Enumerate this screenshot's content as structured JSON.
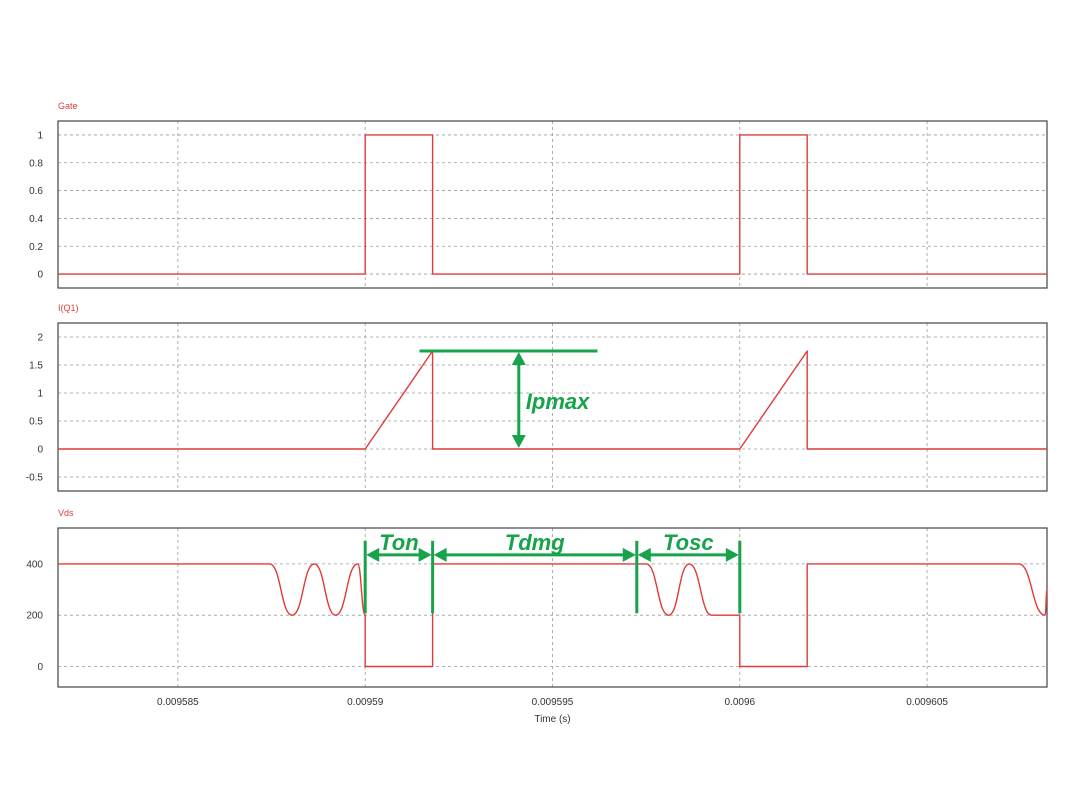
{
  "colors": {
    "trace": "#e03a3a",
    "annotation": "#16a34a"
  },
  "chart_data": {
    "type": "line",
    "xlabel": "Time (s)",
    "x_tick_labels": [
      "0.009585",
      "0.00959",
      "0.009595",
      "0.0096",
      "0.009605"
    ],
    "xlim": [
      0.0095818,
      0.0096082
    ],
    "grid": true,
    "panels": [
      {
        "title": "Gate",
        "ylim": [
          -0.1,
          1.1
        ],
        "y_tick_labels": [
          "1",
          "0.8",
          "0.6",
          "0.4",
          "0.2",
          "0"
        ],
        "series": [
          {
            "name": "Gate",
            "x": [
              0.0095818,
              0.00959,
              0.00959,
              0.0095918,
              0.0095918,
              0.0096,
              0.0096,
              0.0096018,
              0.0096018,
              0.0096082
            ],
            "y": [
              0,
              0,
              1,
              1,
              0,
              0,
              1,
              1,
              0,
              0
            ]
          }
        ]
      },
      {
        "title": "I(Q1)",
        "ylim": [
          -0.75,
          2.25
        ],
        "y_tick_labels": [
          "2",
          "1.5",
          "1",
          "0.5",
          "0",
          "-0.5"
        ],
        "series": [
          {
            "name": "I(Q1)",
            "x": [
              0.0095818,
              0.00959,
              0.0095918,
              0.0095918,
              0.0096,
              0.0096018,
              0.0096018,
              0.0096082
            ],
            "y": [
              0,
              0,
              1.75,
              0,
              0,
              1.75,
              0,
              0
            ]
          }
        ]
      },
      {
        "title": "Vds",
        "ylim": [
          -80,
          540
        ],
        "y_tick_labels": [
          "400",
          "200",
          "0"
        ],
        "series": [
          {
            "name": "Vds",
            "x": [
              0.0095818,
              0.00958745,
              0.00958805,
              0.00958864,
              0.00958921,
              0.0095898,
              0.00959,
              0.00959,
              0.0095918,
              0.0095918,
              0.0095975,
              0.0095981,
              0.00959865,
              0.00959925,
              0.0096,
              0.0096,
              0.0096018,
              0.0096018,
              0.00960745,
              0.00960815,
              0.0096082
            ],
            "y": [
              400,
              400,
              200,
              400,
              200,
              400,
              200,
              0,
              0,
              400,
              400,
              200,
              400,
              200,
              200,
              0,
              0,
              400,
              400,
              200,
              300
            ]
          }
        ]
      }
    ],
    "annotations": [
      {
        "label": "Ipmax",
        "panel": "I(Q1)",
        "type": "vertical-arrow",
        "x": 0.0095941,
        "y_from": 0,
        "y_to": 1.75
      },
      {
        "label": "Ton",
        "panel": "Vds",
        "type": "horizontal-arrow",
        "x_from": 0.00959,
        "x_to": 0.0095918
      },
      {
        "label": "Tdmg",
        "panel": "Vds",
        "type": "horizontal-arrow",
        "x_from": 0.0095918,
        "x_to": 0.00959725
      },
      {
        "label": "Tosc",
        "panel": "Vds",
        "type": "horizontal-arrow",
        "x_from": 0.00959725,
        "x_to": 0.0096
      }
    ]
  }
}
